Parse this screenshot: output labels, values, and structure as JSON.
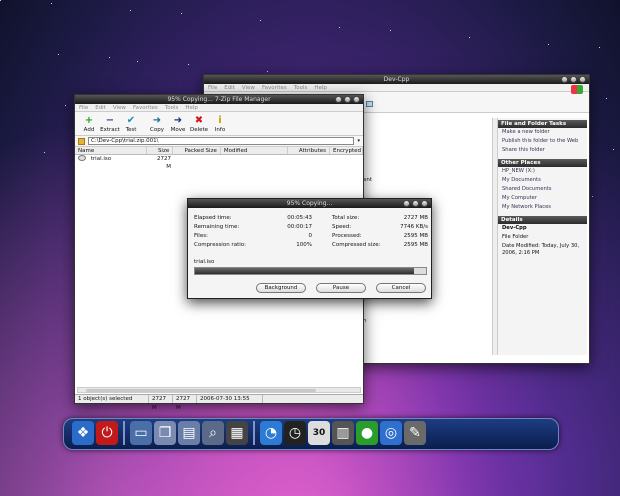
{
  "back_window": {
    "title": "Dev-Cpp",
    "menu": [
      "File",
      "Edit",
      "View",
      "Favorites",
      "Tools",
      "Help"
    ],
    "panel": {
      "tasks_header": "File and Folder Tasks",
      "tasks": [
        "Make a new folder",
        "Publish this folder to the Web",
        "Share this folder"
      ],
      "places_header": "Other Places",
      "places": [
        "HP_NEW (X:)",
        "My Documents",
        "Shared Documents",
        "My Computer",
        "My Network Places"
      ],
      "details_header": "Details",
      "details_name": "Dev-Cpp",
      "details_type": "File Folder",
      "details_modified": "Date Modified: Today, July 30, 2006, 2:16 PM"
    },
    "fragment_text": "ent",
    "fragment_char": "n"
  },
  "front_window": {
    "title": "95% Copying... 7-Zip File Manager",
    "menu": [
      "File",
      "Edit",
      "View",
      "Favorites",
      "Tools",
      "Help"
    ],
    "toolbar": [
      {
        "label": "Add",
        "icon": "add-icon",
        "glyph": "+",
        "color": "#1fa81f"
      },
      {
        "label": "Extract",
        "icon": "extract-icon",
        "glyph": "−",
        "color": "#2c3c9e"
      },
      {
        "label": "Test",
        "icon": "test-icon",
        "glyph": "✔",
        "color": "#1b8fb8"
      },
      {
        "label": "Copy",
        "icon": "copy-icon",
        "glyph": "➜",
        "color": "#19708f"
      },
      {
        "label": "Move",
        "icon": "move-icon",
        "glyph": "➜",
        "color": "#1d2f7a"
      },
      {
        "label": "Delete",
        "icon": "delete-icon",
        "glyph": "✖",
        "color": "#d41515"
      },
      {
        "label": "Info",
        "icon": "info-icon",
        "glyph": "i",
        "color": "#c9a000"
      }
    ],
    "address": "C:\\Dev-Cpp\\trial.zip.001\\",
    "columns": [
      "Name",
      "Size",
      "Packed Size",
      "Modified",
      "Attributes",
      "Encrypted"
    ],
    "rows": [
      {
        "name": "trial.iso",
        "size": "2727 M",
        "packed": "",
        "modified": "",
        "attributes": "",
        "encrypted": ""
      }
    ],
    "status": [
      "1 object(s) selected",
      "2727 M",
      "2727 M",
      "2006-07-30 13:55"
    ]
  },
  "dialog": {
    "title": "95% Copying...",
    "left": [
      {
        "label": "Elapsed time:",
        "value": "00:05:43"
      },
      {
        "label": "Remaining time:",
        "value": "00:00:17"
      },
      {
        "label": "Files:",
        "value": "0"
      },
      {
        "label": "Compression ratio:",
        "value": "100%"
      }
    ],
    "right": [
      {
        "label": "Total size:",
        "value": "2727 MB"
      },
      {
        "label": "Speed:",
        "value": "7746 KB/s"
      },
      {
        "label": "Processed:",
        "value": "2595 MB"
      },
      {
        "label": "Compressed size:",
        "value": "2595 MB"
      }
    ],
    "file": "trial.iso",
    "progress": 0.95,
    "buttons": [
      "Background",
      "Pause",
      "Cancel"
    ]
  },
  "dock": {
    "items": [
      {
        "name": "start-icon",
        "glyph": "❖",
        "bg": "#2a6cc8"
      },
      {
        "name": "power-icon",
        "glyph": "⏻",
        "bg": "#c21a1a"
      },
      {
        "name": "monitor-icon",
        "glyph": "▭",
        "bg": "#4a6ea8"
      },
      {
        "name": "documents-icon",
        "glyph": "❐",
        "bg": "#7a8ab0"
      },
      {
        "name": "folder-icon",
        "glyph": "▤",
        "bg": "#6a7ea8"
      },
      {
        "name": "search-icon",
        "glyph": "⌕",
        "bg": "#5a6a88"
      },
      {
        "name": "calculator-icon",
        "glyph": "▦",
        "bg": "#444"
      },
      {
        "name": "swirl-icon",
        "glyph": "◔",
        "bg": "#2d7bd4"
      },
      {
        "name": "clock-icon",
        "glyph": "◷",
        "bg": "#222"
      },
      {
        "name": "calendar-icon",
        "glyph": "30",
        "bg": "#ddd"
      },
      {
        "name": "trash-icon",
        "glyph": "▥",
        "bg": "#555"
      },
      {
        "name": "mascot-icon",
        "glyph": "●",
        "bg": "#2b9d2b"
      },
      {
        "name": "safari-icon",
        "glyph": "◎",
        "bg": "#2f6fce"
      },
      {
        "name": "brush-icon",
        "glyph": "✎",
        "bg": "#6a6a6a"
      }
    ]
  }
}
